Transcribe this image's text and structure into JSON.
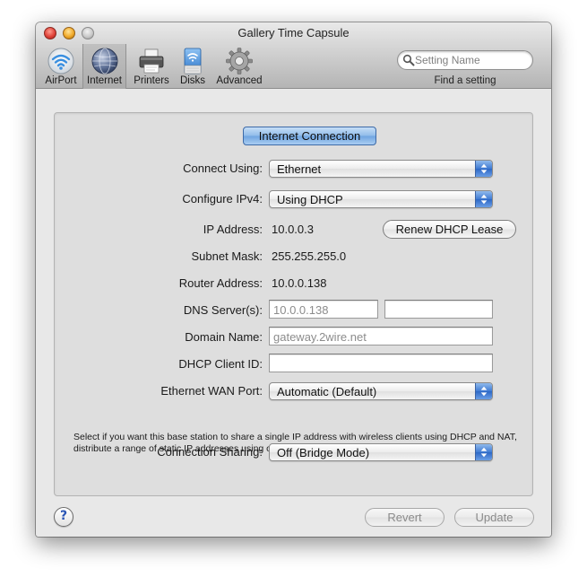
{
  "window": {
    "title": "Gallery Time Capsule"
  },
  "toolbar": {
    "items": [
      {
        "label": "AirPort",
        "icon": "airport-wifi-icon"
      },
      {
        "label": "Internet",
        "icon": "internet-globe-icon",
        "selected": true
      },
      {
        "label": "Printers",
        "icon": "printer-icon"
      },
      {
        "label": "Disks",
        "icon": "disk-icon"
      },
      {
        "label": "Advanced",
        "icon": "gear-icon"
      }
    ],
    "search": {
      "placeholder": "Setting Name",
      "caption": "Find a setting"
    }
  },
  "section_tab": "Internet Connection",
  "form": {
    "connect_using": {
      "label": "Connect Using:",
      "value": "Ethernet"
    },
    "configure_ipv4": {
      "label": "Configure IPv4:",
      "value": "Using DHCP"
    },
    "ip_address": {
      "label": "IP Address:",
      "value": "10.0.0.3"
    },
    "renew_button": "Renew DHCP Lease",
    "subnet_mask": {
      "label": "Subnet Mask:",
      "value": "255.255.255.0"
    },
    "router_address": {
      "label": "Router Address:",
      "value": "10.0.0.138"
    },
    "dns_servers": {
      "label": "DNS Server(s):",
      "primary_placeholder": "10.0.0.138",
      "secondary_value": ""
    },
    "domain_name": {
      "label": "Domain Name:",
      "placeholder": "gateway.2wire.net"
    },
    "dhcp_client_id": {
      "label": "DHCP Client ID:",
      "value": ""
    },
    "ethernet_wan_port": {
      "label": "Ethernet WAN Port:",
      "value": "Automatic (Default)"
    },
    "description": "Select if you want this base station to share a single IP address with wireless clients using DHCP and NAT, distribute a range of static IP addresses using only DHCP, or act as a bridge.",
    "connection_sharing": {
      "label": "Connection Sharing:",
      "value": "Off (Bridge Mode)"
    }
  },
  "footer": {
    "help": "?",
    "revert": "Revert",
    "update": "Update"
  },
  "colors": {
    "accent_blue": "#3f7ad3",
    "tab_blue": "#8fbbea"
  }
}
